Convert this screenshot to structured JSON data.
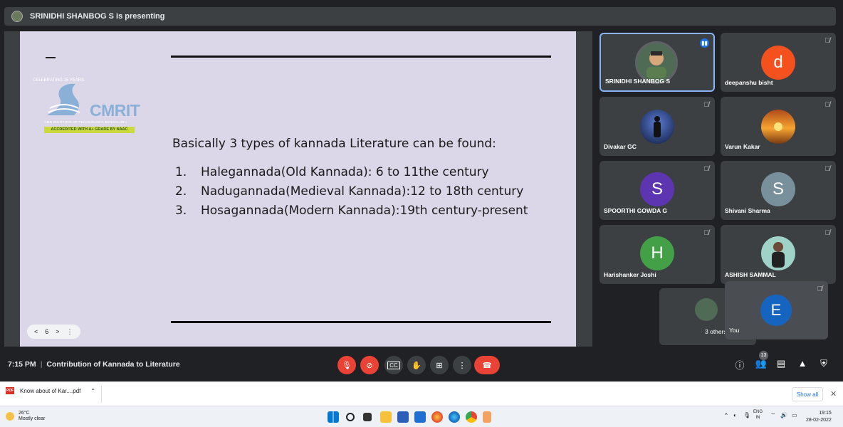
{
  "presenting_banner": "SRINIDHI SHANBOG S is presenting",
  "slide": {
    "logo_text": "CMRIT",
    "logo_arc": "CELEBRATING 25 YEARS",
    "logo_subtitle": "CMR INSTITUTE OF TECHNOLOGY, BENGALURU",
    "logo_badge": "ACCREDITED WITH A+ GRADE BY NAAC",
    "heading": "Basically 3 types of kannada Literature can be found:",
    "items": [
      {
        "num": "1.",
        "text": "Halegannada(Old Kannada): 6 to 11the century"
      },
      {
        "num": "2.",
        "text": "Nadugannada(Medieval Kannada):12 to 18th century"
      },
      {
        "num": "3.",
        "text": "Hosagannada(Modern Kannada):19th century-present"
      }
    ],
    "page": "6",
    "nav_prev": "<",
    "nav_next": ">",
    "nav_more": "⋮"
  },
  "participants": [
    {
      "name": "SRINIDHI SHANBOG S",
      "initial": "",
      "color": "#4f6a55"
    },
    {
      "name": "deepanshu bisht",
      "initial": "d",
      "color": "#f4511e"
    },
    {
      "name": "Divakar GC",
      "initial": "",
      "color": "#1b2a4a"
    },
    {
      "name": "Varun Kakar",
      "initial": "",
      "color": "#e37c22"
    },
    {
      "name": "SPOORTHI GOWDA G",
      "initial": "S",
      "color": "#5e35b1"
    },
    {
      "name": "Shivani Sharma",
      "initial": "S",
      "color": "#78909c"
    },
    {
      "name": "Harishanker Joshi",
      "initial": "H",
      "color": "#43a047"
    },
    {
      "name": "ASHISH SAMMAL",
      "initial": "",
      "color": "#9fd3c7"
    }
  ],
  "others_label": "3 others",
  "you": {
    "name": "You",
    "initial": "E",
    "color": "#1565c0"
  },
  "controls": {
    "time": "7:15 PM",
    "meeting_title": "Contribution of Kannada to Literature",
    "participant_count": "13"
  },
  "download": {
    "file_name": "Know about of Kar....pdf",
    "file_type": "PDF",
    "show_all": "Show all",
    "close": "✕"
  },
  "taskbar": {
    "temperature": "26°C",
    "weather": "Mostly clear",
    "lang_top": "ENG",
    "lang_bottom": "IN",
    "time": "19:15",
    "date": "28-02-2022"
  }
}
